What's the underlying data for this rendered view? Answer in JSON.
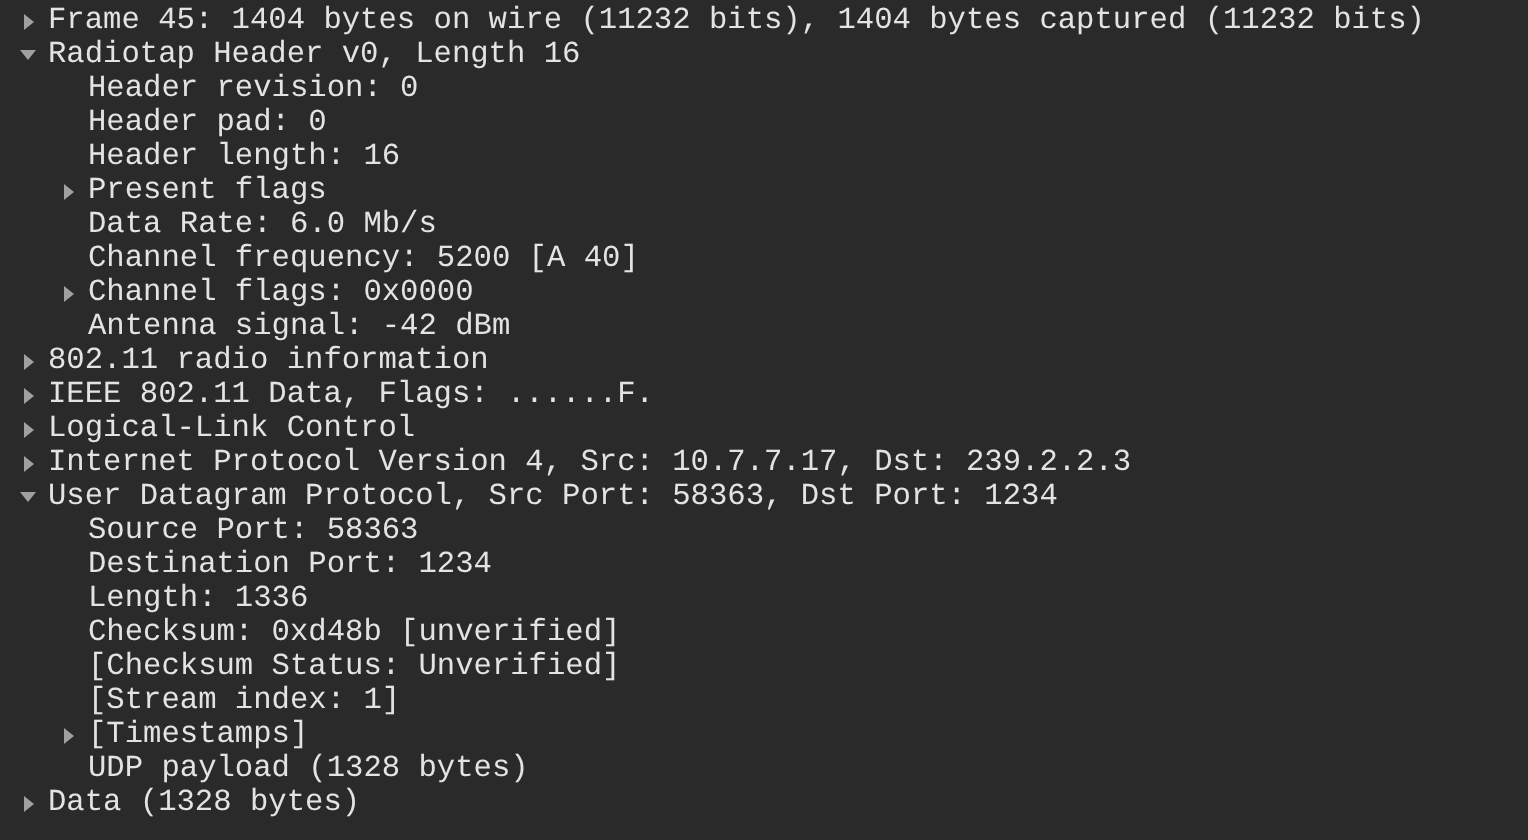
{
  "packet_details": [
    {
      "label": "Frame 45: 1404 bytes on wire (11232 bits), 1404 bytes captured (11232 bits)",
      "expanded": false
    },
    {
      "label": "Radiotap Header v0, Length 16",
      "expanded": true,
      "children": [
        {
          "label": "Header revision: 0"
        },
        {
          "label": "Header pad: 0"
        },
        {
          "label": "Header length: 16"
        },
        {
          "label": "Present flags",
          "expanded": false
        },
        {
          "label": "Data Rate: 6.0 Mb/s"
        },
        {
          "label": "Channel frequency: 5200 [A 40]"
        },
        {
          "label": "Channel flags: 0x0000",
          "expanded": false
        },
        {
          "label": "Antenna signal: -42 dBm"
        }
      ]
    },
    {
      "label": "802.11 radio information",
      "expanded": false
    },
    {
      "label": "IEEE 802.11 Data, Flags: ......F.",
      "expanded": false
    },
    {
      "label": "Logical-Link Control",
      "expanded": false
    },
    {
      "label": "Internet Protocol Version 4, Src: 10.7.7.17, Dst: 239.2.2.3",
      "expanded": false
    },
    {
      "label": "User Datagram Protocol, Src Port: 58363, Dst Port: 1234",
      "expanded": true,
      "children": [
        {
          "label": "Source Port: 58363"
        },
        {
          "label": "Destination Port: 1234"
        },
        {
          "label": "Length: 1336"
        },
        {
          "label": "Checksum: 0xd48b [unverified]"
        },
        {
          "label": "[Checksum Status: Unverified]"
        },
        {
          "label": "[Stream index: 1]"
        },
        {
          "label": "[Timestamps]",
          "expanded": false
        },
        {
          "label": "UDP payload (1328 bytes)"
        }
      ]
    },
    {
      "label": "Data (1328 bytes)",
      "expanded": false
    }
  ]
}
